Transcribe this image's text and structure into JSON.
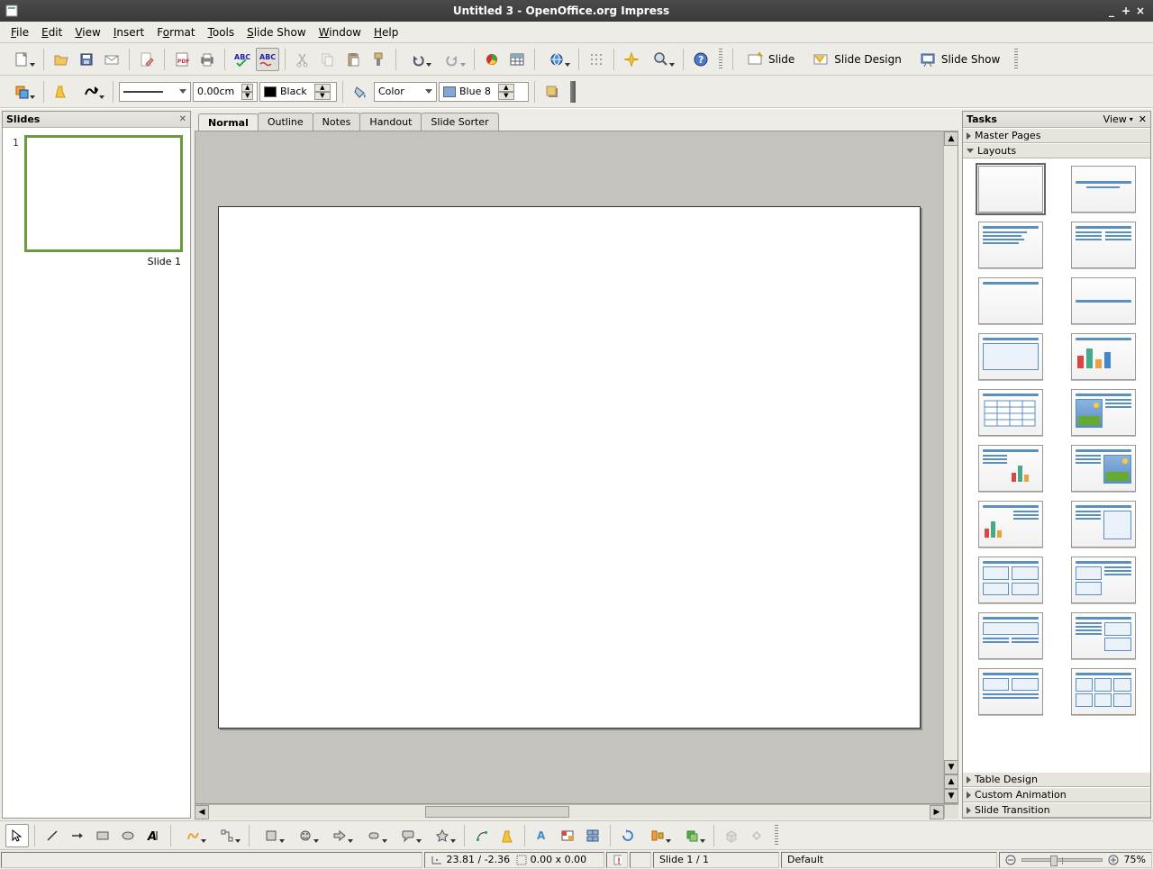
{
  "window": {
    "title": "Untitled 3 - OpenOffice.org Impress"
  },
  "menubar": [
    "File",
    "Edit",
    "View",
    "Insert",
    "Format",
    "Tools",
    "Slide Show",
    "Window",
    "Help"
  ],
  "toolbar2": {
    "line_width": "0.00cm",
    "line_color_label": "Black",
    "fill_mode": "Color",
    "fill_color": "Blue 8"
  },
  "right_buttons": {
    "slide": "Slide",
    "slide_design": "Slide Design",
    "slide_show": "Slide Show"
  },
  "slides_panel": {
    "title": "Slides",
    "items": [
      {
        "num": "1",
        "caption": "Slide 1"
      }
    ]
  },
  "view_tabs": [
    "Normal",
    "Outline",
    "Notes",
    "Handout",
    "Slide Sorter"
  ],
  "view_tabs_active": 0,
  "tasks_panel": {
    "title": "Tasks",
    "view_label": "View",
    "accordions": [
      "Master Pages",
      "Layouts",
      "Table Design",
      "Custom Animation",
      "Slide Transition"
    ],
    "open_index": 1
  },
  "statusbar": {
    "coords": "23.81 / -2.36",
    "size": "0.00 x 0.00",
    "slide_info": "Slide 1 / 1",
    "template": "Default",
    "zoom": "75%"
  }
}
